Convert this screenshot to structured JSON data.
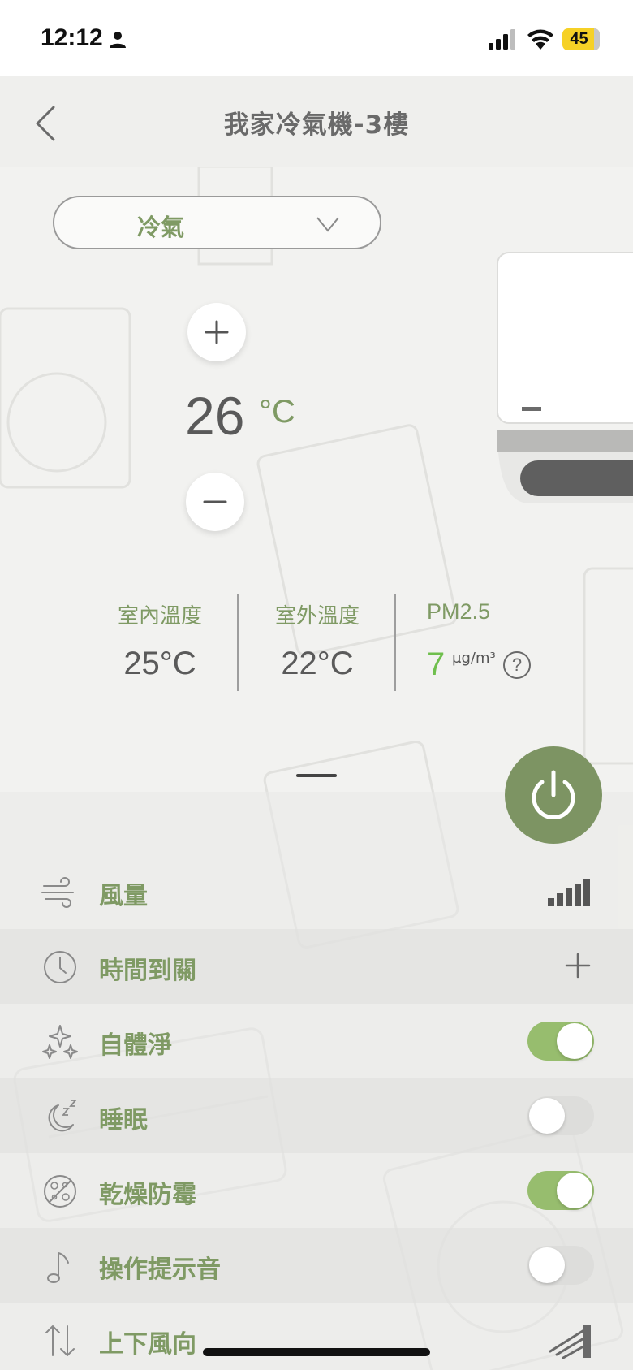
{
  "status_bar": {
    "time": "12:12",
    "battery": "45",
    "icons": [
      "person-icon",
      "signal-icon",
      "wifi-icon",
      "battery-icon"
    ]
  },
  "header": {
    "title": "我家冷氣機-3樓",
    "back_icon": "chevron-left-icon"
  },
  "mode": {
    "selected": "冷氣",
    "dropdown_icon": "chevron-down-icon"
  },
  "temperature": {
    "value": "26",
    "unit": "°C"
  },
  "readings": {
    "indoor": {
      "label": "室內溫度",
      "value": "25°C"
    },
    "outdoor": {
      "label": "室外溫度",
      "value": "22°C"
    },
    "pm25": {
      "label": "PM2.5",
      "value": "7",
      "unit": "μg/m³",
      "help": "?"
    }
  },
  "settings": [
    {
      "label": "風量",
      "icon": "wind-icon",
      "control": "fan-level",
      "level": 5
    },
    {
      "label": "時間到關",
      "icon": "clock-icon",
      "control": "add"
    },
    {
      "label": "自體淨",
      "icon": "sparkle-icon",
      "control": "toggle",
      "on": true
    },
    {
      "label": "睡眠",
      "icon": "moon-sleep-icon",
      "control": "toggle",
      "on": false
    },
    {
      "label": "乾燥防霉",
      "icon": "anti-mold-icon",
      "control": "toggle",
      "on": true
    },
    {
      "label": "操作提示音",
      "icon": "music-note-icon",
      "control": "toggle",
      "on": false
    },
    {
      "label": "上下風向",
      "icon": "up-down-arrows-icon",
      "control": "swing"
    }
  ],
  "colors": {
    "accent_green": "#7f9a64",
    "toggle_on": "#97bd6e",
    "power_button": "#7d9463",
    "pm_value": "#6fbf4d"
  }
}
